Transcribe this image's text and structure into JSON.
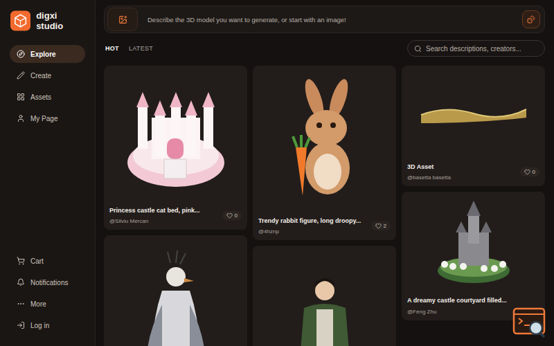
{
  "brand": {
    "name": "digxi studio"
  },
  "sidebar": {
    "items": [
      {
        "label": "Explore",
        "selected": true
      },
      {
        "label": "Create",
        "selected": false
      },
      {
        "label": "Assets",
        "selected": false
      },
      {
        "label": "My Page",
        "selected": false
      }
    ],
    "footer_items": [
      {
        "label": "Cart"
      },
      {
        "label": "Notifications"
      },
      {
        "label": "More"
      },
      {
        "label": "Log in"
      }
    ]
  },
  "prompt": {
    "placeholder": "Describe the 3D model you want to generate, or start with an image!"
  },
  "tabs": [
    {
      "label": "HOT",
      "selected": true
    },
    {
      "label": "LATEST",
      "selected": false
    }
  ],
  "search": {
    "placeholder": "Search descriptions, creators..."
  },
  "columns": [
    [
      {
        "kind": "castle",
        "title": "Princess castle cat bed, pink...",
        "creator": "@Silviu Mercan",
        "likes": "0"
      },
      {
        "kind": "bird"
      }
    ],
    [
      {
        "kind": "rabbit",
        "title": "Trendy rabbit figure, long droopy...",
        "creator": "@4hznp",
        "likes": "2"
      },
      {
        "kind": "soldier"
      }
    ],
    [
      {
        "kind": "text-model",
        "title": "3D Asset",
        "creator": "@basetta basetta",
        "likes": "0"
      },
      {
        "kind": "castle-garden",
        "title": "A dreamy castle courtyard filled...",
        "creator": "@Feng Zhu"
      }
    ]
  ]
}
